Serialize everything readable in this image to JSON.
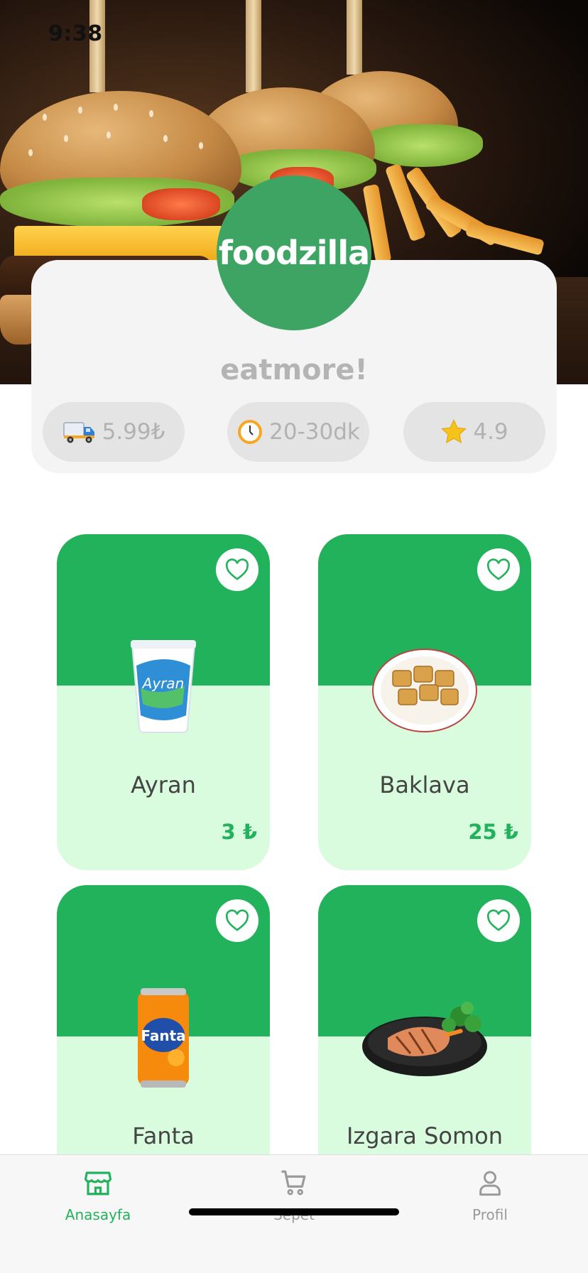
{
  "status_bar": {
    "time": "9:38"
  },
  "restaurant": {
    "logo_text": "foodzilla",
    "tagline": "eatmore!",
    "delivery_fee": "5.99₺",
    "delivery_time": "20-30dk",
    "rating": "4.9"
  },
  "products": [
    {
      "name": "Ayran",
      "price": "3 ₺",
      "image": "ayran-cup"
    },
    {
      "name": "Baklava",
      "price": "25 ₺",
      "image": "baklava-plate"
    },
    {
      "name": "Fanta",
      "price": "",
      "image": "fanta-can"
    },
    {
      "name": "Izgara Somon",
      "price": "",
      "image": "grilled-salmon"
    }
  ],
  "nav": {
    "home": "Anasayfa",
    "cart": "Sepet",
    "profile": "Profil"
  },
  "colors": {
    "brand_green": "#22b25c",
    "logo_green": "#3ea463",
    "card_light": "#d9fbde",
    "muted_gray": "#b4b4b4"
  }
}
